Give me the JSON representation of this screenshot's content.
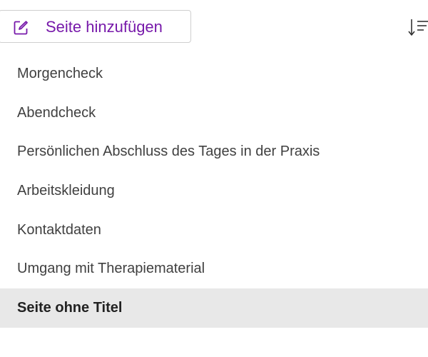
{
  "toolbar": {
    "add_page_label": "Seite hinzufügen",
    "add_page_icon": "edit-square-icon",
    "sort_icon": "sort-icon"
  },
  "colors": {
    "accent": "#7719aa",
    "selected_background": "#e8e8e8",
    "text": "#404040"
  },
  "pages": [
    {
      "label": "Morgencheck",
      "selected": false
    },
    {
      "label": "Abendcheck",
      "selected": false
    },
    {
      "label": "Persönlichen Abschluss des Tages in der Praxis",
      "selected": false
    },
    {
      "label": "Arbeitskleidung",
      "selected": false
    },
    {
      "label": "Kontaktdaten",
      "selected": false
    },
    {
      "label": "Umgang mit Therapiematerial",
      "selected": false
    },
    {
      "label": "Seite ohne Titel",
      "selected": true
    }
  ]
}
